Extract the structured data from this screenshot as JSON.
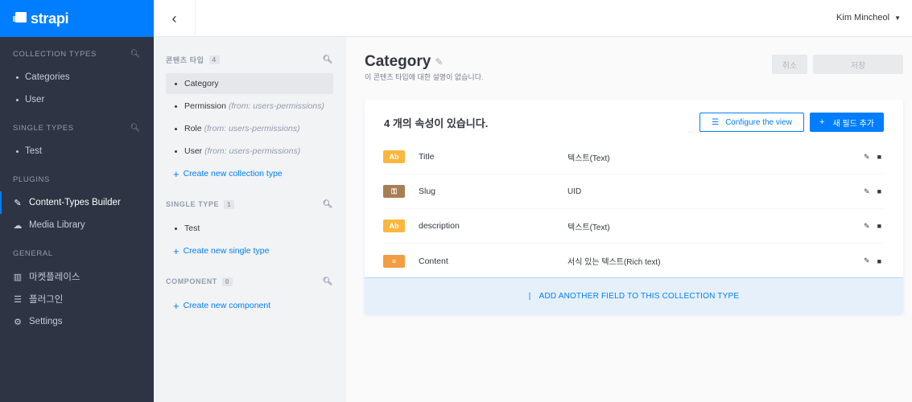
{
  "brand": {
    "name": "strapi"
  },
  "leftnav": {
    "collection_types": {
      "heading": "COLLECTION TYPES",
      "items": [
        "Categories",
        "User"
      ]
    },
    "single_types": {
      "heading": "SINGLE TYPES",
      "items": [
        "Test"
      ]
    },
    "plugins": {
      "heading": "PLUGINS",
      "items": [
        "Content-Types Builder",
        "Media Library"
      ]
    },
    "general": {
      "heading": "GENERAL",
      "items": [
        "마켓플레이스",
        "플러그인",
        "Settings"
      ]
    }
  },
  "topbar": {
    "user_name": "Kim Mincheol"
  },
  "midpanel": {
    "collection": {
      "heading": "콘텐츠 타입",
      "count": "4",
      "items": [
        {
          "name": "Category",
          "from": ""
        },
        {
          "name": "Permission",
          "from": "(from: users-permissions)"
        },
        {
          "name": "Role",
          "from": "(from: users-permissions)"
        },
        {
          "name": "User",
          "from": "(from: users-permissions)"
        }
      ],
      "create_label": "Create new collection type"
    },
    "single": {
      "heading": "SINGLE TYPE",
      "count": "1",
      "items": [
        {
          "name": "Test"
        }
      ],
      "create_label": "Create new single type"
    },
    "component": {
      "heading": "COMPONENT",
      "count": "0",
      "create_label": "Create new component"
    }
  },
  "main": {
    "title": "Category",
    "subtitle": "이 콘텐츠 타입에 대한 설명이 없습니다.",
    "cancel_label": "취소",
    "save_label": "저장",
    "card": {
      "heading": "4 개의 속성이 있습니다.",
      "configure_label": "Configure the view",
      "add_label": "새 필드 추가",
      "fields": [
        {
          "name": "Title",
          "type": "텍스트(Text)",
          "icon": "Ab"
        },
        {
          "name": "Slug",
          "type": "UID",
          "icon": "key-icon"
        },
        {
          "name": "description",
          "type": "텍스트(Text)",
          "icon": "Ab"
        },
        {
          "name": "Content",
          "type": "서식 있는 텍스트(Rich text)",
          "icon": "richtext-icon"
        }
      ],
      "add_another_label": "ADD ANOTHER FIELD TO THIS COLLECTION TYPE"
    }
  },
  "colors": {
    "brand": "#007eff",
    "nav_bg": "#2e3443",
    "text_icon": "#fab73d",
    "uid_icon": "#a87e55",
    "rich_icon": "#f29d41"
  }
}
